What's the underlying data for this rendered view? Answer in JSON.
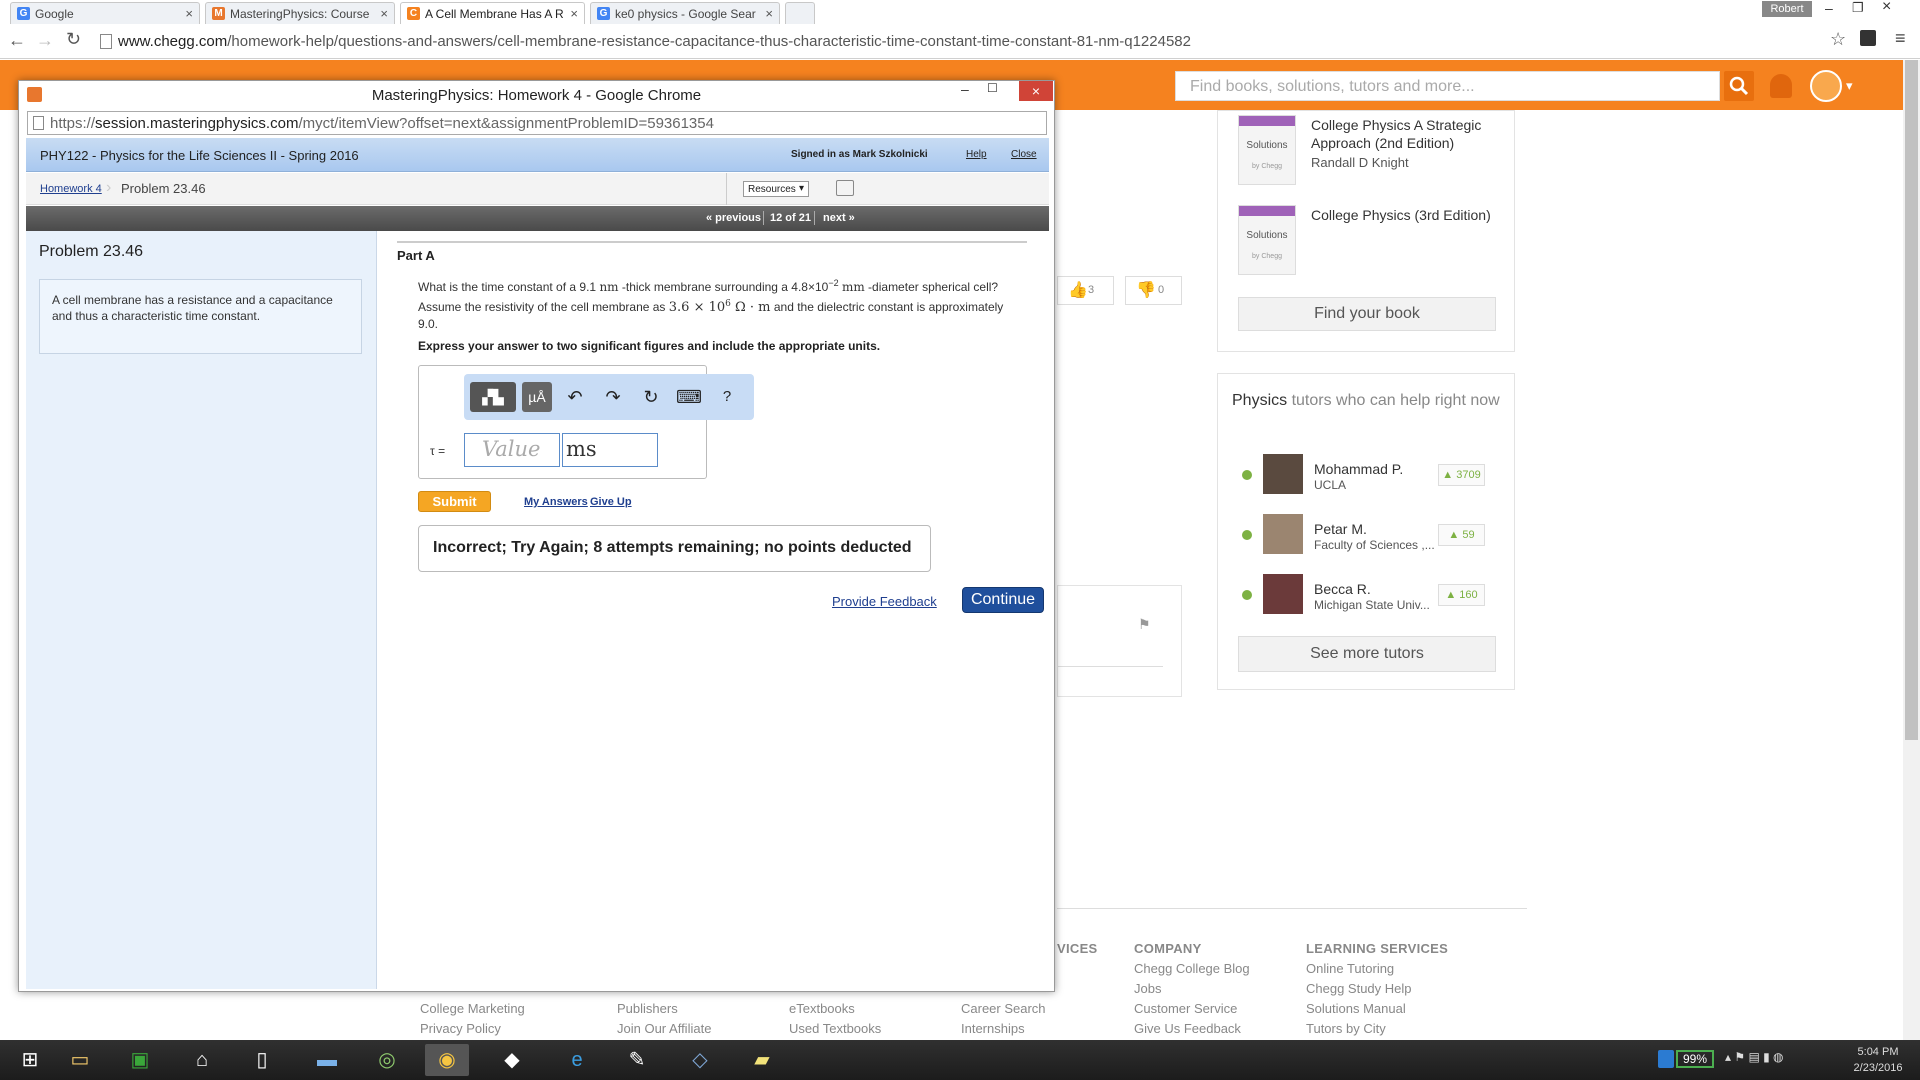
{
  "browser": {
    "tabs": [
      {
        "title": "Google",
        "fav": "G",
        "favcolor": "#4285f4"
      },
      {
        "title": "MasteringPhysics: Course",
        "fav": "M",
        "favcolor": "#e8772e"
      },
      {
        "title": "A Cell Membrane Has A R",
        "fav": "C",
        "favcolor": "#f5821f",
        "active": true
      },
      {
        "title": "ke0 physics - Google Sear",
        "fav": "G",
        "favcolor": "#4285f4"
      }
    ],
    "user": "Robert",
    "url_host": "www.chegg.com",
    "url_path": "/homework-help/questions-and-answers/cell-membrane-resistance-capacitance-thus-characteristic-time-constant-time-constant-81-nm-q1224582"
  },
  "chegg": {
    "search_placeholder": "Find books, solutions, tutors and more...",
    "books": [
      {
        "title": "College Physics A Strategic Approach (2nd Edition)",
        "author": "Randall D Knight",
        "badge": "Solutions",
        "badge_sub": "by Chegg"
      },
      {
        "title": "College Physics (3rd Edition)",
        "author": "",
        "badge": "Solutions",
        "badge_sub": "by Chegg"
      }
    ],
    "find_book": "Find your book",
    "thumbs_up": "3",
    "thumbs_down": "0",
    "tutors_heading_subject": "Physics",
    "tutors_heading_rest": " tutors who can help right now",
    "tutors": [
      {
        "name": "Mohammad P.",
        "school": "UCLA",
        "likes": "3709"
      },
      {
        "name": "Petar M.",
        "school": "Faculty of Sciences ,...",
        "likes": "59"
      },
      {
        "name": "Becca R.",
        "school": "Michigan State Univ...",
        "likes": "160"
      }
    ],
    "see_more_tutors": "See more tutors",
    "footer": {
      "col_partial_heading": "VICES",
      "company_heading": "COMPANY",
      "company_links": [
        "Chegg College Blog",
        "Jobs",
        "Customer Service",
        "Give Us Feedback"
      ],
      "learning_heading": "LEARNING SERVICES",
      "learning_links": [
        "Online Tutoring",
        "Chegg Study Help",
        "Solutions Manual",
        "Tutors by City"
      ],
      "bottom_cols": [
        [
          "College Marketing",
          "Privacy Policy"
        ],
        [
          "Publishers",
          "Join Our Affiliate"
        ],
        [
          "eTextbooks",
          "Used Textbooks"
        ],
        [
          "Career Search",
          "Internships"
        ]
      ]
    }
  },
  "popup": {
    "title": "MasteringPhysics: Homework 4 - Google Chrome",
    "url_scheme": "https://",
    "url_host": "session.masteringphysics.com",
    "url_path": "/myct/itemView?offset=next&assignmentProblemID=59361354",
    "course": "PHY122 - Physics for the Life Sciences II - Spring 2016",
    "signed_in": "Signed in as Mark Szkolnicki",
    "help": "Help",
    "close": "Close",
    "crumb_link": "Homework 4",
    "crumb_current": "Problem 23.46",
    "resources": "Resources",
    "previous": "« previous",
    "counter": "12 of 21",
    "next": "next »",
    "problem_title": "Problem 23.46",
    "problem_intro": "A cell membrane has a resistance and a capacitance and thus a characteristic time constant.",
    "part": "Part A",
    "q_1": "What is the time constant of a 9.1 ",
    "q_nm": "nm",
    "q_2": " -thick membrane surrounding a 4.8×10",
    "q_exp": "−2",
    "q_mm": "mm",
    "q_3": " -diameter spherical cell? Assume the resistivity of the cell membrane as ",
    "q_rho": "3.6 × 10",
    "q_rho_exp": "6",
    "q_rho_unit": " Ω · m",
    "q_4": " and the dielectric constant is approximately 9.0.",
    "instruction": "Express your answer to two significant figures and include the appropriate units.",
    "toolbar": [
      "templates",
      "µÅ",
      "↶",
      "↷",
      "↻",
      "⌨",
      "?"
    ],
    "tau_label": "τ =",
    "value_placeholder": "Value",
    "unit_value": "ms",
    "submit": "Submit",
    "my_answers": "My Answers",
    "give_up": "Give Up",
    "feedback": "Incorrect; Try Again; 8 attempts remaining; no points deducted",
    "provide_feedback": "Provide Feedback",
    "continue": "Continue"
  },
  "taskbar": {
    "battery": "99%",
    "time": "5:04 PM",
    "date": "2/23/2016"
  }
}
